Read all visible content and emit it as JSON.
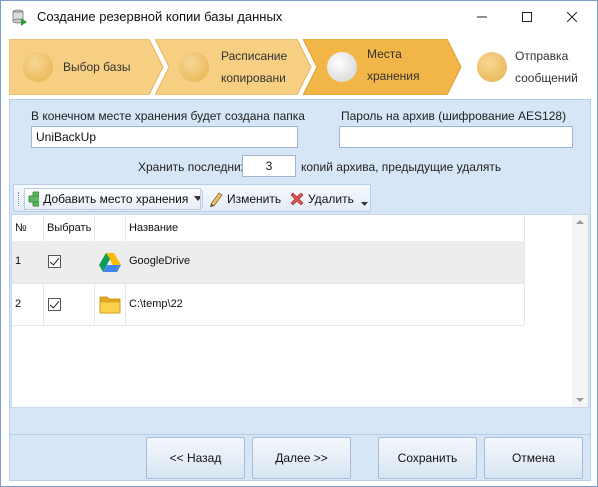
{
  "window": {
    "title": "Создание резервной копии базы данных",
    "icon": "database-backup-icon"
  },
  "steps": [
    {
      "label_lines": [
        "Выбор базы"
      ],
      "state": "done"
    },
    {
      "label_lines": [
        "Расписание",
        "копировани"
      ],
      "state": "done"
    },
    {
      "label_lines": [
        "Места",
        "хранения"
      ],
      "state": "current"
    },
    {
      "label_lines": [
        "Отправка",
        "сообщений"
      ],
      "state": "pending"
    }
  ],
  "form": {
    "folder_label": "В конечном месте хранения будет создана папка",
    "folder_value": "UniBackUp",
    "password_label": "Пароль на архив (шифрование AES128)",
    "password_value": "",
    "keep_label": "Хранить последних",
    "keep_value": "3",
    "keep_suffix": "копий архива, предыдущие удалять"
  },
  "toolbar": {
    "add_label": "Добавить место хранения",
    "edit_label": "Изменить",
    "delete_label": "Удалить"
  },
  "grid": {
    "columns": [
      "№",
      "Выбрать",
      "",
      "Название"
    ],
    "rows": [
      {
        "num": "1",
        "checked": true,
        "icon": "google-drive-icon",
        "name": "GoogleDrive"
      },
      {
        "num": "2",
        "checked": true,
        "icon": "folder-icon",
        "name": "C:\\temp\\22"
      }
    ]
  },
  "buttons": {
    "back": "<< Назад",
    "next": "Далее >>",
    "save": "Сохранить",
    "cancel": "Отмена"
  },
  "colors": {
    "step_done": "#f6cf82",
    "step_current": "#f2b548",
    "panel": "#d6e6f7"
  }
}
